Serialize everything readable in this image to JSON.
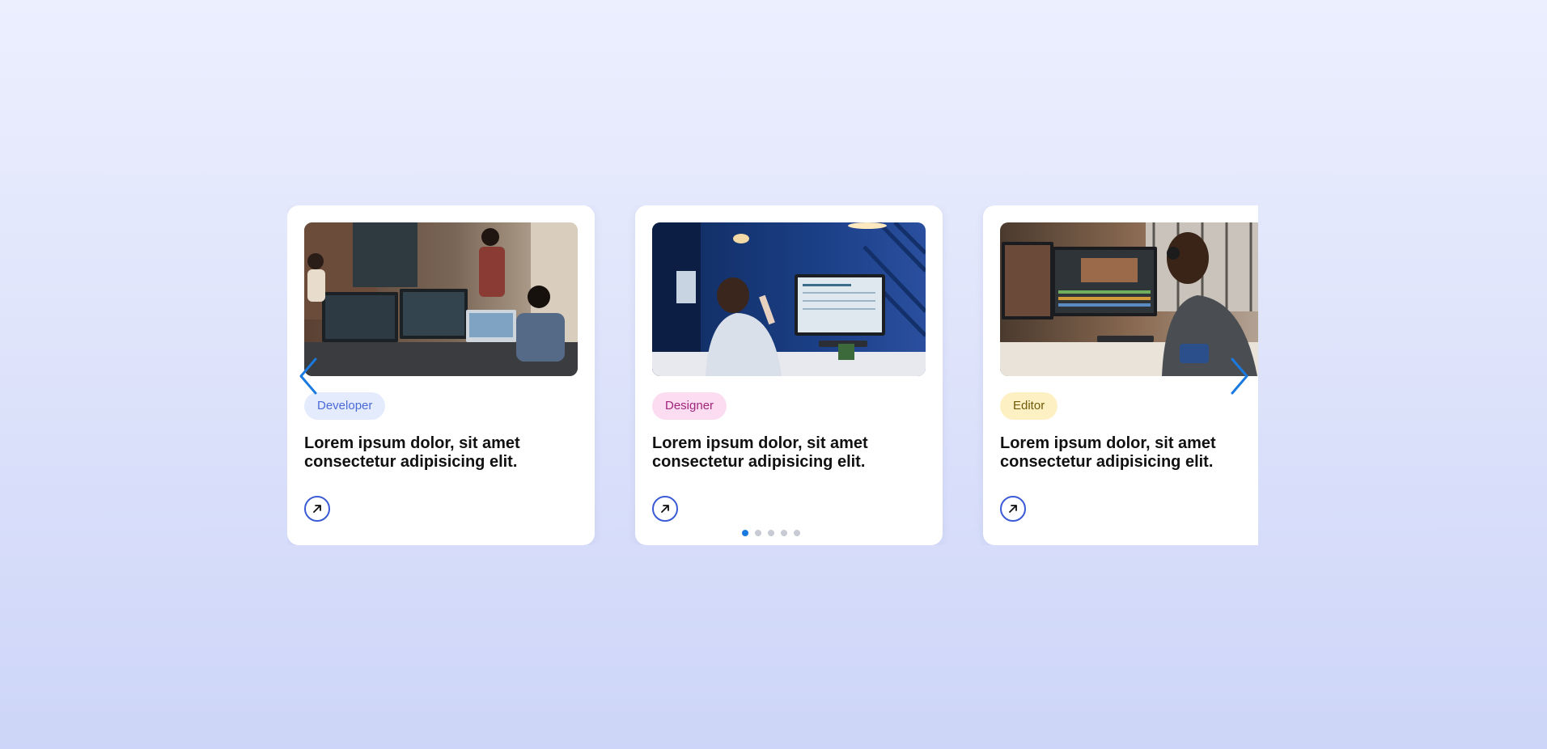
{
  "colors": {
    "accent": "#1a7ae0",
    "link_button_border": "#3b5bd6",
    "dot_inactive": "#c8cbd3",
    "developer_tag_bg": "#e3ebfd",
    "developer_tag_text": "#4a6ad8",
    "designer_tag_bg": "#fbdcf0",
    "designer_tag_text": "#a0257a",
    "editor_tag_bg": "#fdf1c4",
    "editor_tag_text": "#6e5a08"
  },
  "carousel": {
    "prev_icon": "chevron-left-icon",
    "next_icon": "chevron-right-icon",
    "cards": [
      {
        "image": "photo of a development team working at computers",
        "tag": "Developer",
        "title": "Lorem ipsum dolor, sit amet consectetur adipisicing elit.",
        "link_icon": "arrow-up-right-icon"
      },
      {
        "image": "photo of a designer sketching at a workstation at night",
        "tag": "Designer",
        "title": "Lorem ipsum dolor, sit amet consectetur adipisicing elit.",
        "link_icon": "arrow-up-right-icon"
      },
      {
        "image": "photo of a video editor with headphones at dual monitors",
        "tag": "Editor",
        "title": "Lorem ipsum dolor, sit amet consectetur adipisicing elit.",
        "link_icon": "arrow-up-right-icon"
      }
    ],
    "pagination": {
      "total": 5,
      "active_index": 0
    }
  }
}
